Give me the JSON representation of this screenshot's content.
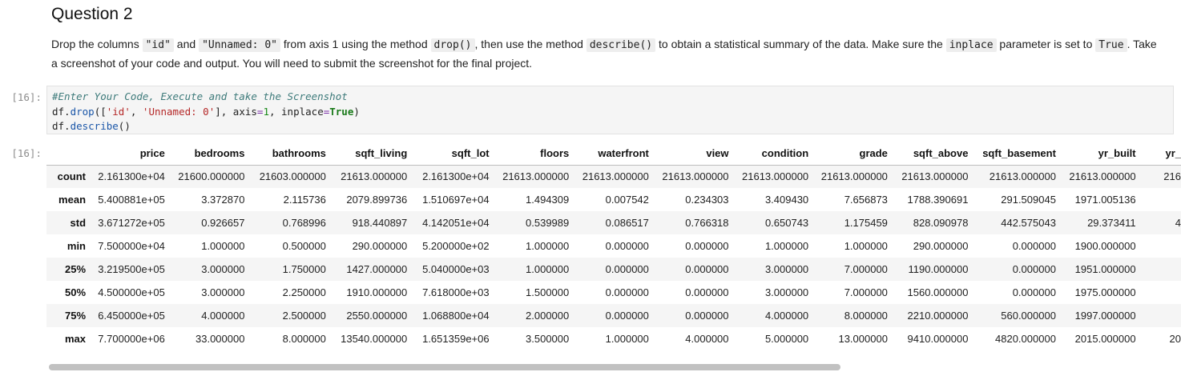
{
  "question": {
    "title": "Question 2",
    "text": [
      "Drop the columns ",
      "\"id\"",
      " and ",
      "\"Unnamed: 0\"",
      " from axis 1 using the method ",
      "drop()",
      ", then use the method ",
      "describe()",
      " to obtain a statistical summary of the data. Make sure the ",
      "inplace",
      " parameter is set to ",
      "True",
      ". Take a screenshot of your code and output. You will need to submit the screenshot for the final project."
    ]
  },
  "cell": {
    "in_prompt": "[16]:",
    "out_prompt": "[16]:",
    "code": {
      "comment": "#Enter Your Code, Execute and take the Screenshot",
      "line2": {
        "obj": "df.",
        "fn": "drop",
        "open": "([",
        "s1": "'id'",
        "comma": ", ",
        "s2": "'Unnamed: 0'",
        "close": "], axis",
        "eq": "=",
        "num": "1",
        "sep": ", inplace",
        "eq2": "=",
        "kw": "True",
        "end": ")"
      },
      "line3": {
        "obj": "df.",
        "fn": "describe",
        "end": "()"
      }
    }
  },
  "table": {
    "columns": [
      "price",
      "bedrooms",
      "bathrooms",
      "sqft_living",
      "sqft_lot",
      "floors",
      "waterfront",
      "view",
      "condition",
      "grade",
      "sqft_above",
      "sqft_basement",
      "yr_built",
      "yr_"
    ],
    "rows": [
      {
        "label": "count",
        "values": [
          "2.161300e+04",
          "21600.000000",
          "21603.000000",
          "21613.000000",
          "2.161300e+04",
          "21613.000000",
          "21613.000000",
          "21613.000000",
          "21613.000000",
          "21613.000000",
          "21613.000000",
          "21613.000000",
          "21613.000000",
          "216"
        ]
      },
      {
        "label": "mean",
        "values": [
          "5.400881e+05",
          "3.372870",
          "2.115736",
          "2079.899736",
          "1.510697e+04",
          "1.494309",
          "0.007542",
          "0.234303",
          "3.409430",
          "7.656873",
          "1788.390691",
          "291.509045",
          "1971.005136",
          ""
        ]
      },
      {
        "label": "std",
        "values": [
          "3.671272e+05",
          "0.926657",
          "0.768996",
          "918.440897",
          "4.142051e+04",
          "0.539989",
          "0.086517",
          "0.766318",
          "0.650743",
          "1.175459",
          "828.090978",
          "442.575043",
          "29.373411",
          "4"
        ]
      },
      {
        "label": "min",
        "values": [
          "7.500000e+04",
          "1.000000",
          "0.500000",
          "290.000000",
          "5.200000e+02",
          "1.000000",
          "0.000000",
          "0.000000",
          "1.000000",
          "1.000000",
          "290.000000",
          "0.000000",
          "1900.000000",
          ""
        ]
      },
      {
        "label": "25%",
        "values": [
          "3.219500e+05",
          "3.000000",
          "1.750000",
          "1427.000000",
          "5.040000e+03",
          "1.000000",
          "0.000000",
          "0.000000",
          "3.000000",
          "7.000000",
          "1190.000000",
          "0.000000",
          "1951.000000",
          ""
        ]
      },
      {
        "label": "50%",
        "values": [
          "4.500000e+05",
          "3.000000",
          "2.250000",
          "1910.000000",
          "7.618000e+03",
          "1.500000",
          "0.000000",
          "0.000000",
          "3.000000",
          "7.000000",
          "1560.000000",
          "0.000000",
          "1975.000000",
          ""
        ]
      },
      {
        "label": "75%",
        "values": [
          "6.450000e+05",
          "4.000000",
          "2.500000",
          "2550.000000",
          "1.068800e+04",
          "2.000000",
          "0.000000",
          "0.000000",
          "4.000000",
          "8.000000",
          "2210.000000",
          "560.000000",
          "1997.000000",
          ""
        ]
      },
      {
        "label": "max",
        "values": [
          "7.700000e+06",
          "33.000000",
          "8.000000",
          "13540.000000",
          "1.651359e+06",
          "3.500000",
          "1.000000",
          "4.000000",
          "5.000000",
          "13.000000",
          "9410.000000",
          "4820.000000",
          "2015.000000",
          "20"
        ]
      }
    ]
  }
}
